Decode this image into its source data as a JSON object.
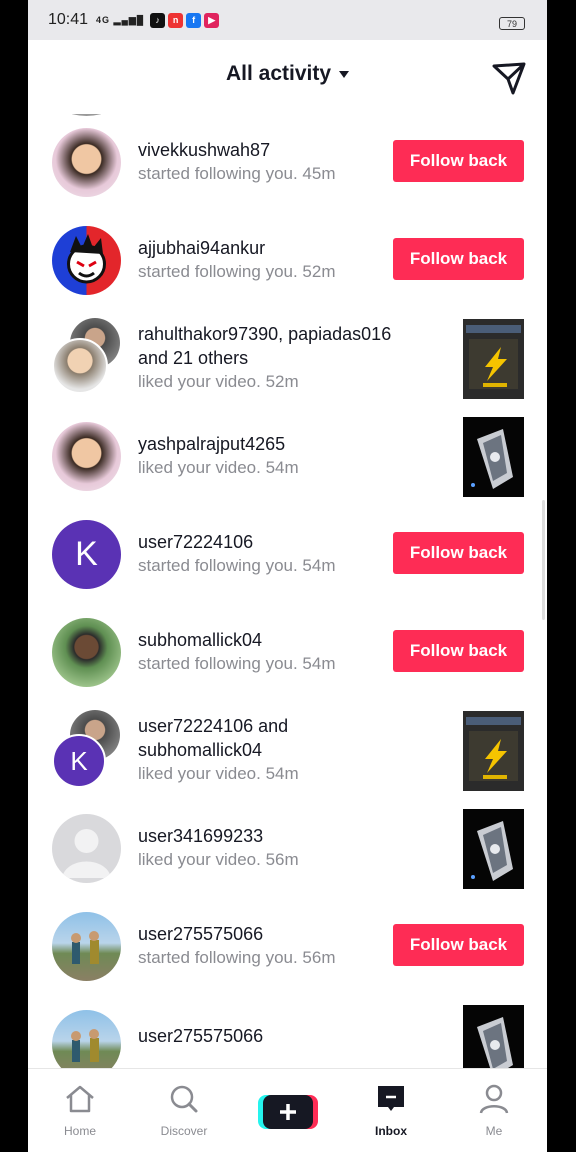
{
  "status": {
    "time": "10:41",
    "signal": "4G",
    "battery": "79"
  },
  "header": {
    "title": "All activity"
  },
  "activities": [
    {
      "avatar_type": "photo",
      "lines": [
        {
          "t": "vivekkushwah87",
          "c": "dark"
        },
        {
          "t": "started following you. 45m",
          "c": "gray"
        }
      ],
      "action": "follow",
      "button": "Follow back"
    },
    {
      "avatar_type": "logo",
      "lines": [
        {
          "t": "ajjubhai94ankur",
          "c": "dark"
        },
        {
          "t": "started following you. 52m",
          "c": "gray"
        }
      ],
      "action": "follow",
      "button": "Follow back"
    },
    {
      "avatar_type": "group",
      "lines": [
        {
          "t": "rahulthakor97390, papiadas016",
          "c": "dark"
        },
        {
          "t": "and 21 others",
          "c": "dark"
        },
        {
          "t": "liked your video. 52m",
          "c": "gray"
        }
      ],
      "action": "thumb",
      "thumb": "game"
    },
    {
      "avatar_type": "photo",
      "lines": [
        {
          "t": "yashpalrajput4265",
          "c": "dark"
        },
        {
          "t": "liked your video. 54m",
          "c": "gray"
        }
      ],
      "action": "thumb",
      "thumb": "gun"
    },
    {
      "avatar_type": "letter",
      "letter": "K",
      "lines": [
        {
          "t": "user72224106",
          "c": "dark"
        },
        {
          "t": "started following you. 54m",
          "c": "gray"
        }
      ],
      "action": "follow",
      "button": "Follow back"
    },
    {
      "avatar_type": "photo2",
      "lines": [
        {
          "t": "subhomallick04",
          "c": "dark"
        },
        {
          "t": "started following you. 54m",
          "c": "gray"
        }
      ],
      "action": "follow",
      "button": "Follow back"
    },
    {
      "avatar_type": "group-k",
      "letter": "K",
      "lines": [
        {
          "t": "user72224106 and",
          "c": "dark"
        },
        {
          "t": "subhomallick04",
          "c": "dark"
        },
        {
          "t": "liked your video. 54m",
          "c": "gray"
        }
      ],
      "action": "thumb",
      "thumb": "game"
    },
    {
      "avatar_type": "default",
      "lines": [
        {
          "t": "user341699233",
          "c": "dark"
        },
        {
          "t": "liked your video. 56m",
          "c": "gray"
        }
      ],
      "action": "thumb",
      "thumb": "gun"
    },
    {
      "avatar_type": "game",
      "lines": [
        {
          "t": "user275575066",
          "c": "dark"
        },
        {
          "t": "started following you. 56m",
          "c": "gray"
        }
      ],
      "action": "follow",
      "button": "Follow back"
    },
    {
      "avatar_type": "game",
      "lines": [
        {
          "t": "user275575066",
          "c": "dark"
        }
      ],
      "action": "thumb",
      "thumb": "gun"
    }
  ],
  "tabs": [
    {
      "label": "Home",
      "icon": "home-icon"
    },
    {
      "label": "Discover",
      "icon": "search-icon"
    },
    {
      "label": "",
      "icon": "create-plus-icon"
    },
    {
      "label": "Inbox",
      "icon": "inbox-icon",
      "active": true
    },
    {
      "label": "Me",
      "icon": "profile-icon"
    }
  ],
  "colors": {
    "accent": "#fe2c55",
    "text": "#161823",
    "muted": "#8a8b91"
  }
}
